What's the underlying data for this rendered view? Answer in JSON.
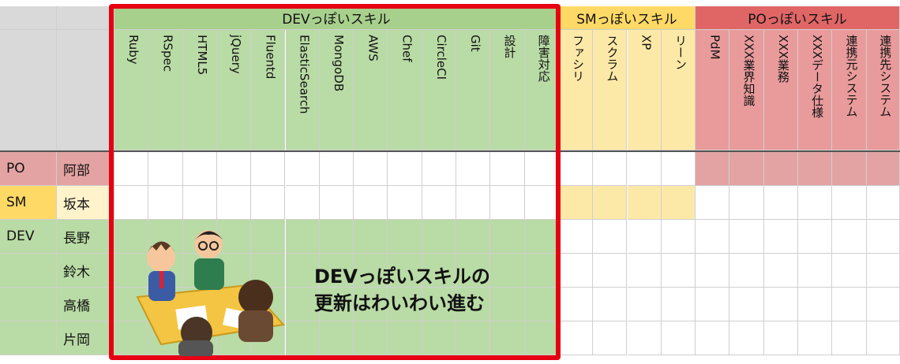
{
  "groups": [
    {
      "label": "DEVっぽいスキル",
      "color": "#a8d08d"
    },
    {
      "label": "SMっぽいスキル",
      "color": "#ffd966"
    },
    {
      "label": "POっぽいスキル",
      "color": "#e06666"
    }
  ],
  "skills_dev": [
    "Ruby",
    "RSpec",
    "HTML5",
    "jQuery",
    "Fluentd",
    "ElasticSearch",
    "MongoDB",
    "AWS",
    "Chef",
    "CircleCI",
    "Git",
    "設計",
    "障害対応"
  ],
  "skills_sm": [
    "ファシリ",
    "スクラム",
    "XP",
    "リーン"
  ],
  "skills_po": [
    "PdM",
    "XXX業界知識",
    "XXX業務",
    "XXXデータ仕様",
    "連携元システム",
    "連携先システム"
  ],
  "rows": [
    {
      "role": "PO",
      "name": "阿部"
    },
    {
      "role": "SM",
      "name": "坂本"
    },
    {
      "role": "DEV",
      "name": "長野"
    },
    {
      "role": "",
      "name": "鈴木"
    },
    {
      "role": "",
      "name": "高橋"
    },
    {
      "role": "",
      "name": "片岡"
    }
  ],
  "callout": {
    "line1": "DEVっぽいスキルの",
    "line2": "更新はわいわい進む"
  },
  "colors": {
    "dev_header": "#a8d08d",
    "dev_fill": "#b9dba5",
    "sm_header": "#ffd966",
    "sm_fill": "#fde9a7",
    "po_header": "#e06666",
    "po_fill": "#e99b9b",
    "po_row": "#e4a3a3",
    "gray": "#d9d9d9",
    "frame": "#e60012"
  }
}
